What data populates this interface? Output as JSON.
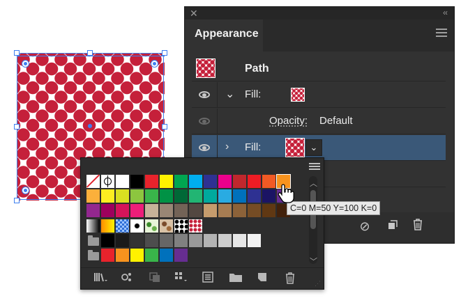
{
  "panel": {
    "title": "Appearance",
    "rows": [
      {
        "label": "Path"
      },
      {
        "label": "Fill:"
      },
      {
        "label": "Opacity:",
        "value": "Default"
      },
      {
        "label": "Fill:"
      }
    ],
    "bottom_icons": [
      "clear-appearance-icon",
      "duplicate-item-icon",
      "delete-item-icon"
    ]
  },
  "popup": {
    "rows": [
      [
        "none",
        "registration",
        "#ffffff",
        "#000000",
        "#e8232c",
        "#fff200",
        "#00a651",
        "#00aeef",
        "#2e3192",
        "#ec008c",
        "#c1272d",
        "#ed1c24",
        "#f15a24",
        "#f7931e"
      ],
      [
        "#fbb03b",
        "#fcee21",
        "#d9e021",
        "#8cc63f",
        "#39b54a",
        "#009245",
        "#006837",
        "#22b573",
        "#00a99d",
        "#29abe2",
        "#0071bc",
        "#2e3192",
        "#1b1464",
        "#662d91"
      ],
      [
        "#93278f",
        "#9e005d",
        "#d4145a",
        "#ed1e79",
        "#c7b299",
        "#998675",
        "#736357",
        "#534741",
        "#c69c6d",
        "#a67c52",
        "#8c6239",
        "#754c24",
        "#603813",
        "#42210b"
      ]
    ],
    "pattern_row": [
      "gradient-black-white",
      "gradient-orange-yellow",
      "pattern-blue-check",
      "pattern-halftone",
      "pattern-green-leaf",
      "pattern-brown-paisley",
      "pattern-black-dots",
      "pattern-red-dots"
    ],
    "gray_row": [
      "#000000",
      "#1a1a1a",
      "#333333",
      "#4d4d4d",
      "#666666",
      "#808080",
      "#999999",
      "#b3b3b3",
      "#cccccc",
      "#e6e6e6",
      "#f2f2f2"
    ],
    "color_group_row": [
      "#e8232c",
      "#f7931e",
      "#fff200",
      "#39b54a",
      "#0071bc",
      "#662d91"
    ],
    "footer_icons": [
      "swatch-libraries-icon",
      "show-kinds-icon",
      "swatch-options-icon",
      "new-color-group-icon",
      "new-swatch-icon",
      "delete-swatch-icon"
    ]
  },
  "tooltip": "C=0 M=50 Y=100 K=0",
  "colors": {
    "accent": "#3d7ff0",
    "selected_row": "#3a5878",
    "dot_red": "#c5203a"
  }
}
